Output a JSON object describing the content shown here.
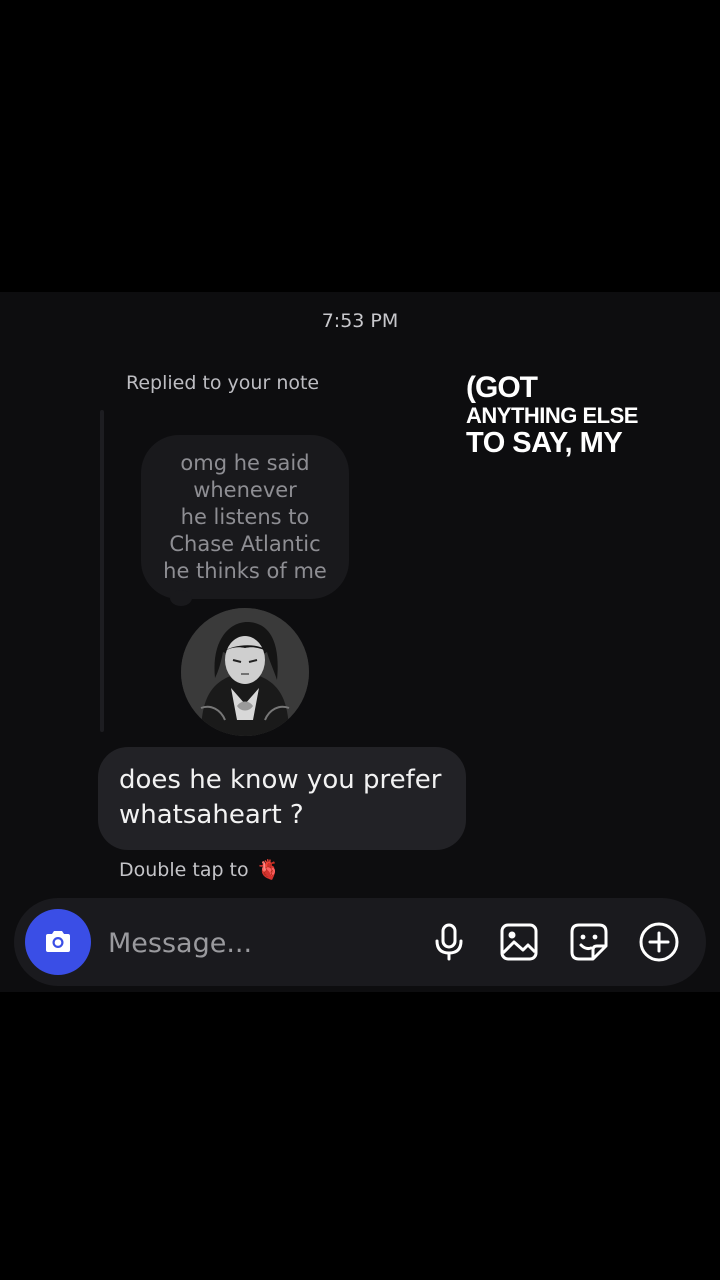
{
  "thread": {
    "timestamp": "7:53 PM",
    "reply_context": "Replied to your note",
    "note": {
      "lines": [
        "omg he said",
        "whenever",
        "he listens to",
        "Chase Atlantic",
        "he thinks of me"
      ]
    },
    "message": {
      "lines": [
        "does he know you prefer",
        "whatsaheart ?"
      ]
    },
    "hint_text": "Double tap to",
    "hint_emoji": "🫀"
  },
  "overlay": {
    "line1": "(GOT",
    "line2": "ANYTHING ELSE",
    "line3": "TO SAY, MY"
  },
  "composer": {
    "placeholder": "Message...",
    "icons": [
      "camera-icon",
      "microphone-icon",
      "image-icon",
      "sticker-icon",
      "plus-icon"
    ]
  },
  "colors": {
    "accent": "#3a4ee6",
    "background": "#000000",
    "chat_background": "#0d0d0f",
    "bubble": "#222226"
  }
}
